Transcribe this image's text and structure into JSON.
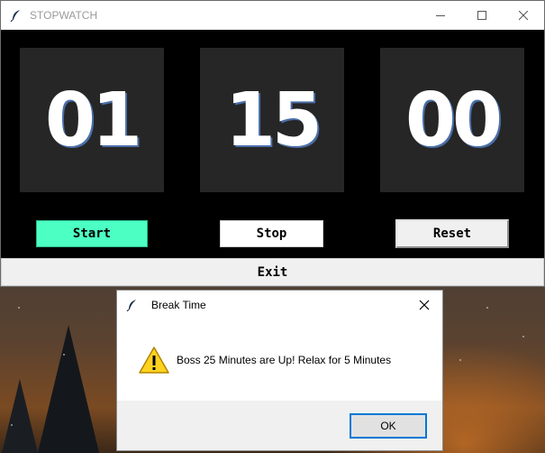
{
  "desktop": {
    "background": "night-sky-wallpaper"
  },
  "stopwatch_window": {
    "title": "STOPWATCH",
    "app_icon": "feather-icon",
    "controls": {
      "minimize": "minimize-icon",
      "maximize": "maximize-icon",
      "close": "close-icon"
    },
    "time": {
      "hours": "01",
      "minutes": "15",
      "seconds": "00"
    },
    "buttons": {
      "start": "Start",
      "stop": "Stop",
      "reset": "Reset",
      "exit": "Exit"
    },
    "colors": {
      "background": "#000000",
      "panel": "#262626",
      "start_button": "#4cffc3"
    }
  },
  "dialog": {
    "title": "Break Time",
    "app_icon": "feather-icon",
    "close_icon": "close-icon",
    "icon": "warning-icon",
    "message": "Boss 25 Minutes are Up! Relax for 5 Minutes",
    "ok_label": "OK",
    "colors": {
      "ok_border": "#0078d7",
      "warning": "#ffd700"
    }
  }
}
